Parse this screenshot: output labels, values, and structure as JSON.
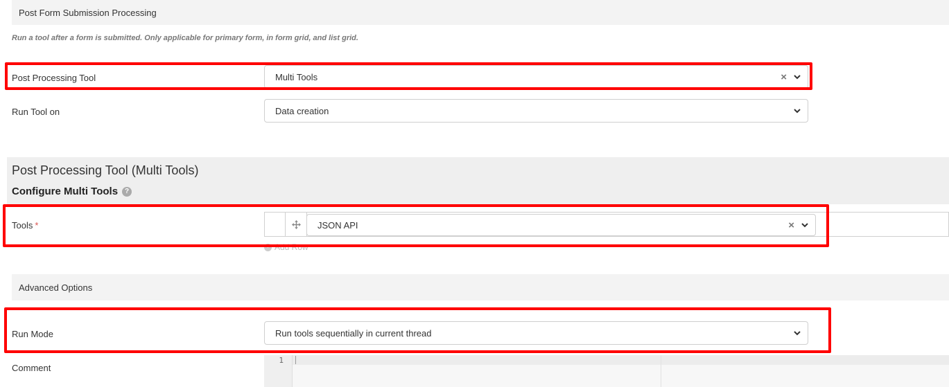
{
  "post_form": {
    "section_title": "Post Form Submission Processing",
    "description": "Run a tool after a form is submitted. Only applicable for primary form, in form grid, and list grid.",
    "post_processing_tool": {
      "label": "Post Processing Tool",
      "value": "Multi Tools",
      "clear": "×"
    },
    "run_tool_on": {
      "label": "Run Tool on",
      "value": "Data creation"
    }
  },
  "multi_tools": {
    "title": "Post Processing Tool (Multi Tools)",
    "configure": "Configure Multi Tools",
    "help": "?",
    "tools": {
      "label": "Tools",
      "required": "*",
      "row_value": "JSON API",
      "clear": "×"
    },
    "add_row": "Add Row",
    "add_icon": "+"
  },
  "advanced": {
    "section_title": "Advanced Options",
    "run_mode": {
      "label": "Run Mode",
      "value": "Run tools sequentially in current thread"
    },
    "comment": {
      "label": "Comment",
      "line_number": "1"
    }
  },
  "colors": {
    "highlight": "#ff0000",
    "section_bg": "#f3f3f3"
  }
}
